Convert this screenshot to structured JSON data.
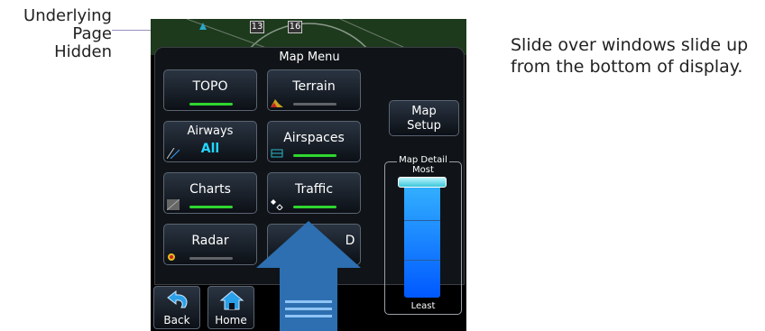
{
  "annotations": {
    "left_line1": "Underlying",
    "left_line2": "Page",
    "left_line3": "Hidden",
    "right_line1": "Slide over windows slide up",
    "right_line2": "from the bottom of display."
  },
  "map": {
    "runway_left": "13",
    "runway_right": "16"
  },
  "panel": {
    "title": "Map Menu",
    "buttons": [
      {
        "label": "TOPO",
        "bar": "on",
        "icon": "none"
      },
      {
        "label": "Terrain",
        "bar": "off",
        "icon": "terrain-icon"
      },
      {
        "label": "Airways",
        "value": "All",
        "bar": "none",
        "icon": "airways-icon"
      },
      {
        "label": "Airspaces",
        "bar": "on",
        "icon": "airspace-icon"
      },
      {
        "label": "Charts",
        "bar": "on",
        "icon": "chart-icon"
      },
      {
        "label": "Traffic",
        "bar": "on",
        "icon": "traffic-icon"
      },
      {
        "label": "Radar",
        "bar": "off",
        "icon": "radar-icon"
      },
      {
        "label": "D",
        "bar": "off",
        "icon": "hidden-behind-arrow"
      }
    ],
    "map_setup": {
      "line1": "Map",
      "line2": "Setup"
    },
    "map_detail": {
      "title": "Map Detail",
      "top_label": "Most",
      "bottom_label": "Least",
      "level": "Most"
    }
  },
  "nav": {
    "back_label": "Back",
    "home_label": "Home"
  },
  "colors": {
    "active_bar": "#2fd62f",
    "inactive_bar": "#606468",
    "accent_cyan": "#22d7ff",
    "arrow": "#2d6fb0"
  }
}
